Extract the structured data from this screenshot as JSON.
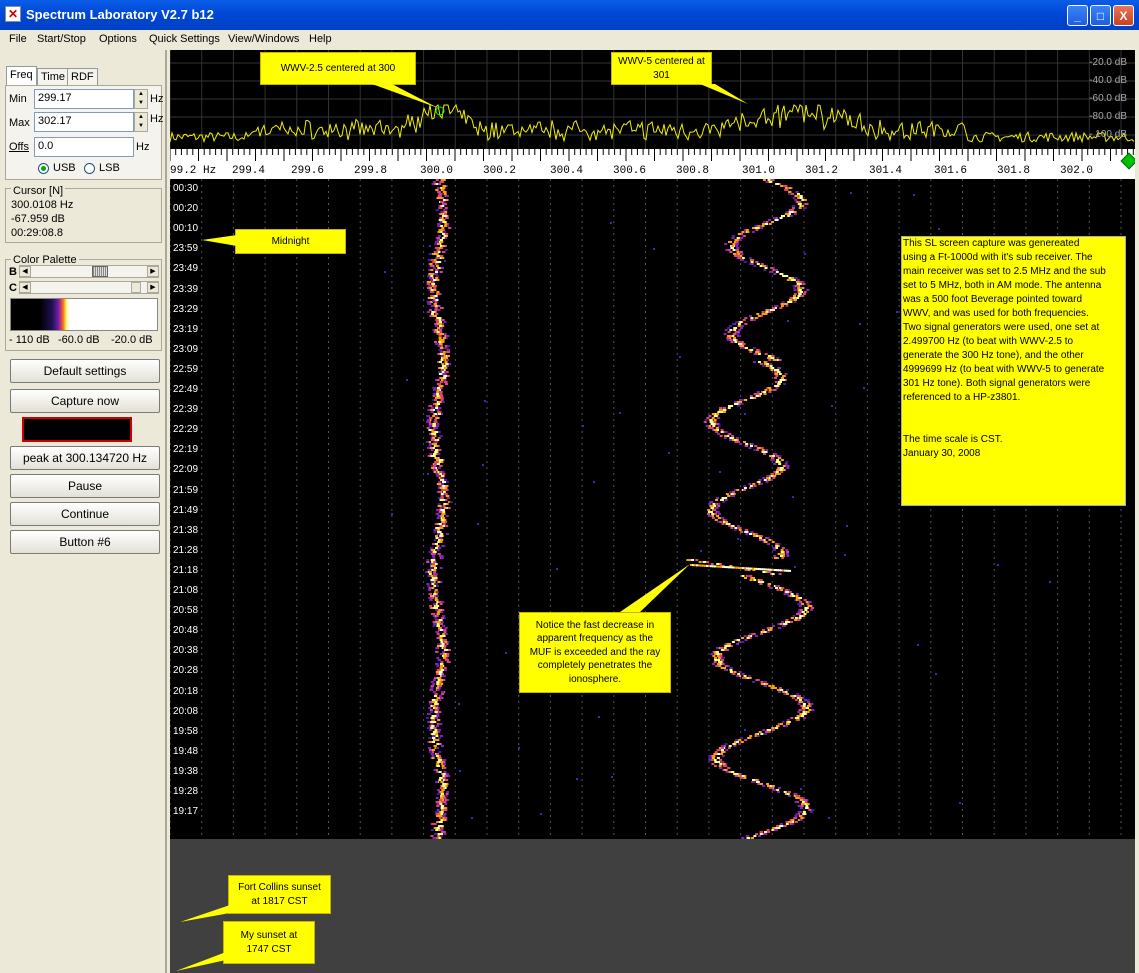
{
  "window": {
    "title": "Spectrum Laboratory V2.7 b12",
    "min_label": "_",
    "max_label": "□",
    "close_label": "X"
  },
  "menu": {
    "items": [
      "File",
      "Start/Stop",
      "Options",
      "Quick Settings",
      "View/Windows",
      "Help"
    ]
  },
  "tabs": [
    "Freq",
    "Time",
    "RDF"
  ],
  "freq_panel": {
    "min_label": "Min",
    "min_value": "299.17",
    "max_label": "Max",
    "max_value": "302.17",
    "offs_label": "Offs",
    "offs_value": "0.0",
    "unit": "Hz",
    "usb_label": "USB",
    "lsb_label": "LSB",
    "selected": "USB"
  },
  "cursor": {
    "title": "Cursor [N]",
    "freq": "300.0108 Hz",
    "level": "-67.959 dB",
    "time": "00:29:08.8"
  },
  "palette": {
    "title": "Color Palette",
    "b_label": "B",
    "c_label": "C",
    "b_position": 0.62,
    "c_position": 0.97,
    "scale_labels": [
      "- 110 dB",
      "-60.0 dB",
      "-20.0 dB"
    ]
  },
  "buttons": {
    "default_settings": "Default settings",
    "capture_now": "Capture now",
    "peak": "peak at 300.134720 Hz",
    "pause": "Pause",
    "continue": "Continue",
    "button6": "Button #6"
  },
  "colors": {
    "accent_title": "#0048d6",
    "trace": "#f0f000",
    "callout": "#ffff00",
    "indicator_border": "#cc0000"
  },
  "spectrum": {
    "db_labels": [
      "-20.0 dB",
      "-40.0 dB",
      "-60.0 dB",
      "-80.0 dB",
      "- 100 dB"
    ]
  },
  "freq_axis": {
    "labels": [
      "99.2 Hz",
      "299.4",
      "299.6",
      "299.8",
      "300.0",
      "300.2",
      "300.4",
      "300.6",
      "300.8",
      "301.0",
      "301.2",
      "301.4",
      "301.6",
      "301.8",
      "302.0"
    ]
  },
  "waterfall": {
    "time_labels": [
      "00:30",
      "00:20",
      "00:10",
      "23:59",
      "23:49",
      "23:39",
      "23:29",
      "23:19",
      "23:09",
      "22:59",
      "22:49",
      "22:39",
      "22:29",
      "22:19",
      "22:09",
      "21:59",
      "21:49",
      "21:38",
      "21:28",
      "21:18",
      "21:08",
      "20:58",
      "20:48",
      "20:38",
      "20:28",
      "20:18",
      "20:08",
      "19:58",
      "19:48",
      "19:38",
      "19:28",
      "19:17"
    ]
  },
  "callouts": {
    "wwv25": "WWV-2.5  centered at 300",
    "wwv5": "WWV-5 centered at 301",
    "midnight": "Midnight",
    "notice": [
      "Notice the fast decrease in",
      "apparent frequency as the",
      "MUF is exceeded and the ray",
      "completely penetrates the",
      "ionosphere."
    ],
    "fort_collins": [
      "Fort Collins sunset",
      "at 1817 CST"
    ],
    "my_sunset": [
      "My sunset at",
      "1747 CST"
    ],
    "note": [
      "This SL screen capture was genereated",
      "using a Ft-1000d with it's sub receiver. The",
      "main receiver was set to 2.5 MHz and the sub",
      "set to 5 MHz, both in AM mode. The antenna",
      "was a 500 foot Beverage pointed toward",
      "WWV, and was used for both frequencies.",
      "Two signal generators were used, one set at",
      "2.499700 Hz (to beat with WWV-2.5 to",
      "generate the 300 Hz tone), and the other",
      "4999699 Hz (to beat with WWV-5 to generate",
      "301 Hz tone).  Both signal generators were",
      "referenced to a HP-z3801.",
      "",
      "",
      "The time scale is CST.",
      "January 30, 2008"
    ]
  }
}
